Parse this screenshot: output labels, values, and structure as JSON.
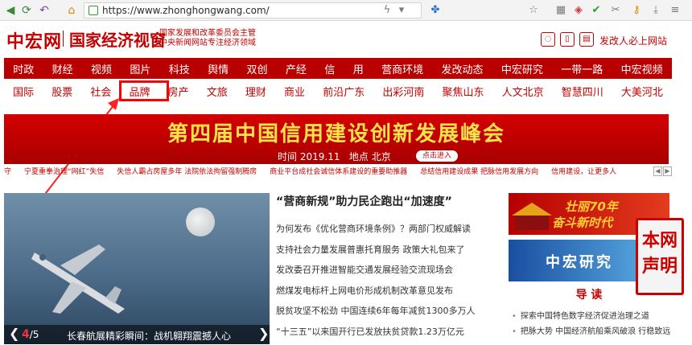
{
  "browser": {
    "url": "https://www.zhonghongwang.com/"
  },
  "header": {
    "logo_cn": "中宏网",
    "logo_sub": "国家经济视窗",
    "slogan_line1": "国家发展和改革委员会主管",
    "slogan_line2": "中央新闻网站专注经济领域",
    "top_link": "发改人必上网站"
  },
  "nav_main": [
    "时政",
    "财经",
    "视频",
    "图片",
    "科技",
    "舆情",
    "双创",
    "产经",
    "信",
    "用",
    "营商环境",
    "发改动态",
    "中宏研究",
    "一带一路",
    "中宏视频"
  ],
  "nav_sub": [
    "国际",
    "股票",
    "社会",
    "品牌",
    "房产",
    "文旅",
    "理财",
    "商业",
    "前沿广东",
    "出彩河南",
    "聚焦山东",
    "人文北京",
    "智慧四川",
    "大美河北"
  ],
  "banner": {
    "title": "第四届中国信用建设创新发展峰会",
    "time_label": "时间",
    "time_value": "2019.11",
    "place_label": "地点",
    "place_value": "北京",
    "button": "点击进入"
  },
  "ticker": [
    "守",
    "宁夏重拳治理“网红”失信",
    "失信人霸占房屋多年 法院依法拘留强制腾房",
    "商业平台成社会诚信体系建设的重要助推器",
    "总结信用建设成果 把脉信用发展方向",
    "信用建设，让更多人"
  ],
  "slideshow": {
    "current": "4",
    "total": "/5",
    "caption": "长春航展精彩瞬间：战机翱翔震撼人心"
  },
  "headline": "“营商新规”助力民企跑出“加速度”",
  "news": [
    "为何发布《优化营商环境条例》？两部门权威解读",
    "支持社会力量发展普惠托育服务 政策大礼包来了",
    "发改委召开推进智能交通发展经验交流现场会",
    "燃煤发电标杆上网电价形成机制改革意见发布",
    "脱贫攻坚不松劲 中国连续6年每年减贫1300多万人",
    "“十三五”以来国开行已发放扶贫贷款1.23万亿元"
  ],
  "right": {
    "banner1_line1": "壮丽70年",
    "banner1_line2": "奋斗新时代",
    "banner2": "中宏研究",
    "stamp": [
      "本网",
      "声明"
    ],
    "guide_title": "导 读",
    "guide_items": [
      "探索中国特色数字经济促进治理之道",
      "把脉大势 中国经济航船乘风破浪 行稳致远"
    ]
  },
  "colors": {
    "brand_red": "#c40000",
    "nav_red": "#b80000",
    "highlight": "#ff0000"
  }
}
